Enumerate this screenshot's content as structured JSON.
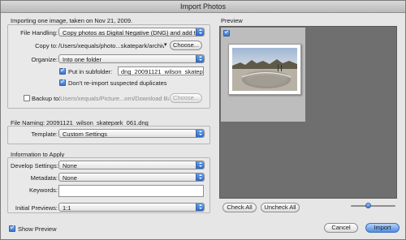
{
  "window": {
    "title": "Import Photos"
  },
  "summary": "Importing one image, taken on Nov 21, 2009.",
  "file_handling": {
    "label": "File Handling:",
    "value": "Copy photos as Digital Negative (DNG) and add to catalog"
  },
  "copy_to": {
    "label": "Copy to:",
    "value": "/Users/xequals/photo...skatepark/archive/dng",
    "choose_label": "Choose..."
  },
  "organize": {
    "label": "Organize:",
    "value": "Into one folder"
  },
  "subfolder": {
    "checkbox_label": "Put in subfolder:",
    "checked": true,
    "value": "dng_20091121_wilson_skatepark"
  },
  "no_reimport": {
    "label": "Don't re-import suspected duplicates",
    "checked": true
  },
  "backup": {
    "label": "Backup to:",
    "checked": false,
    "value": "/Users/xequals/Picture...orn/Download Backups",
    "choose_label": "Choose..."
  },
  "file_naming": {
    "label": "File Naming:",
    "value": "20091121_wilson_skatepark_061.dng"
  },
  "template": {
    "label": "Template:",
    "value": "Custom Settings"
  },
  "info_section": {
    "title": "Information to Apply"
  },
  "develop_settings": {
    "label": "Develop Settings:",
    "value": "None"
  },
  "metadata": {
    "label": "Metadata:",
    "value": "None"
  },
  "keywords": {
    "label": "Keywords:",
    "value": ""
  },
  "initial_previews": {
    "label": "Initial Previews:",
    "value": "1:1"
  },
  "preview": {
    "label": "Preview",
    "check_all": "Check All",
    "uncheck_all": "Uncheck All",
    "thumbnail_checked": true,
    "thumbnail_size_fraction": 0.4
  },
  "show_preview": {
    "label": "Show Preview",
    "checked": true
  },
  "buttons": {
    "cancel": "Cancel",
    "import": "Import"
  },
  "colors": {
    "accent": "#3474d2",
    "dialog_bg": "#e6e6e6",
    "preview_bg": "#6f6f6f"
  },
  "icons": [
    "chevron-updown-icon",
    "check-icon"
  ]
}
